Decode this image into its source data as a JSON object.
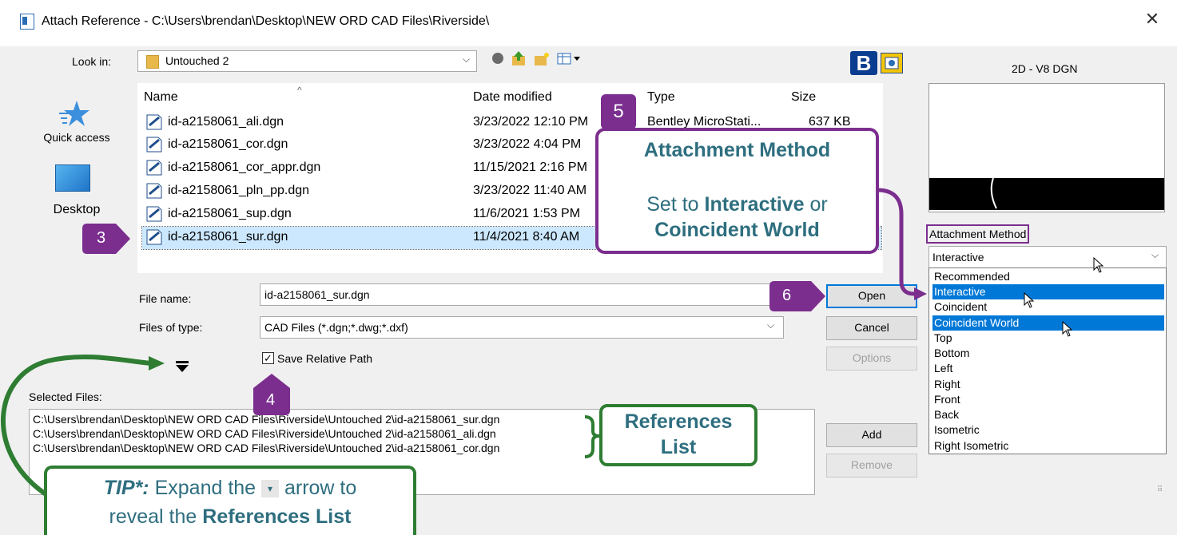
{
  "window": {
    "title": "Attach Reference - C:\\Users\\brendan\\Desktop\\NEW ORD CAD Files\\Riverside\\",
    "close_glyph": "✕"
  },
  "lookin": {
    "label": "Look in:",
    "value": "Untouched 2"
  },
  "places": [
    {
      "label": "Quick access",
      "icon": "star-icon"
    },
    {
      "label": "Desktop",
      "icon": "desktop-icon"
    }
  ],
  "columns": {
    "name": "Name",
    "date": "Date modified",
    "type": "Type",
    "size": "Size"
  },
  "files": [
    {
      "name": "id-a2158061_ali.dgn",
      "date": "3/23/2022 12:10 PM",
      "type": "Bentley MicroStati...",
      "size": "637 KB"
    },
    {
      "name": "id-a2158061_cor.dgn",
      "date": "3/23/2022 4:04 PM",
      "type": "",
      "size": ""
    },
    {
      "name": "id-a2158061_cor_appr.dgn",
      "date": "11/15/2021 2:16 PM",
      "type": "",
      "size": ""
    },
    {
      "name": "id-a2158061_pln_pp.dgn",
      "date": "3/23/2022 11:40 AM",
      "type": "",
      "size": ""
    },
    {
      "name": "id-a2158061_sup.dgn",
      "date": "11/6/2021 1:53 PM",
      "type": "",
      "size": ""
    },
    {
      "name": "id-a2158061_sur.dgn",
      "date": "11/4/2021 8:40 AM",
      "type": "",
      "size": ""
    }
  ],
  "filename": {
    "label": "File name:",
    "value": "id-a2158061_sur.dgn"
  },
  "filetype": {
    "label": "Files of type:",
    "value": "CAD Files (*.dgn;*.dwg;*.dxf)"
  },
  "save_relative": {
    "label": "Save Relative Path",
    "checked": true
  },
  "buttons": {
    "open": "Open",
    "cancel": "Cancel",
    "options": "Options",
    "add": "Add",
    "remove": "Remove"
  },
  "selected_files": {
    "label": "Selected Files:",
    "items": [
      "C:\\Users\\brendan\\Desktop\\NEW ORD CAD Files\\Riverside\\Untouched 2\\id-a2158061_sur.dgn",
      "C:\\Users\\brendan\\Desktop\\NEW ORD CAD Files\\Riverside\\Untouched 2\\id-a2158061_ali.dgn",
      "C:\\Users\\brendan\\Desktop\\NEW ORD CAD Files\\Riverside\\Untouched 2\\id-a2158061_cor.dgn"
    ]
  },
  "preview": {
    "label": "2D - V8 DGN"
  },
  "attachment": {
    "label": "Attachment Method",
    "selected": "Interactive",
    "options": [
      "Recommended",
      "Interactive",
      "Coincident",
      "Coincident World",
      "Top",
      "Bottom",
      "Left",
      "Right",
      "Front",
      "Back",
      "Isometric",
      "Right Isometric"
    ],
    "highlighted": [
      "Interactive",
      "Coincident World"
    ]
  },
  "annotations": {
    "step3": "3",
    "step4": "4",
    "step5": "5",
    "step6": "6",
    "callout5_title": "Attachment Method",
    "callout5_line1_pre": "Set to ",
    "callout5_line1_bold": "Interactive",
    "callout5_line1_post": " or",
    "callout5_line2": "Coincident World",
    "references_line1": "References",
    "references_line2": "List",
    "tip_bold": "TIP*:",
    "tip_text1": " Expand the ",
    "tip_text2": " arrow to",
    "tip_line2_pre": "reveal the ",
    "tip_line2_bold": "References List"
  },
  "colors": {
    "purple": "#7b2e8e",
    "green": "#2e7d32",
    "selection_blue": "#0078d7",
    "row_select": "#cce8ff"
  }
}
